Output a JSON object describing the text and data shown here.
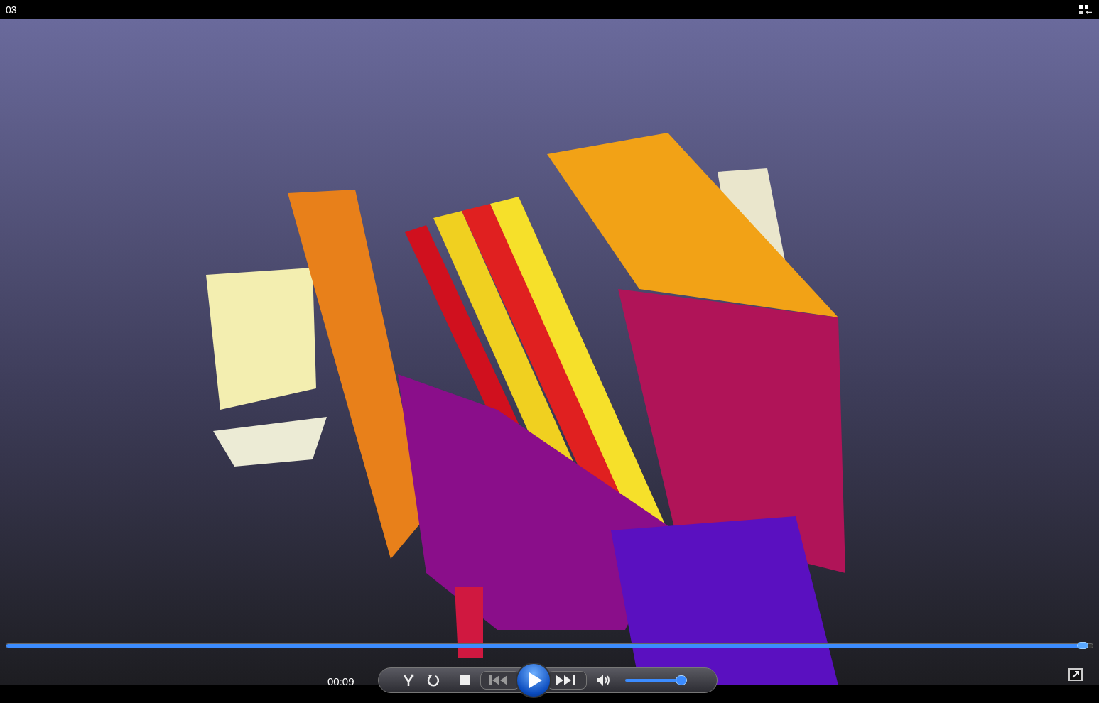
{
  "window": {
    "title": "03"
  },
  "seek_bar": {
    "level": 0.99
  },
  "controls": {
    "time": "00:09",
    "volume": {
      "level": 0.92
    }
  }
}
